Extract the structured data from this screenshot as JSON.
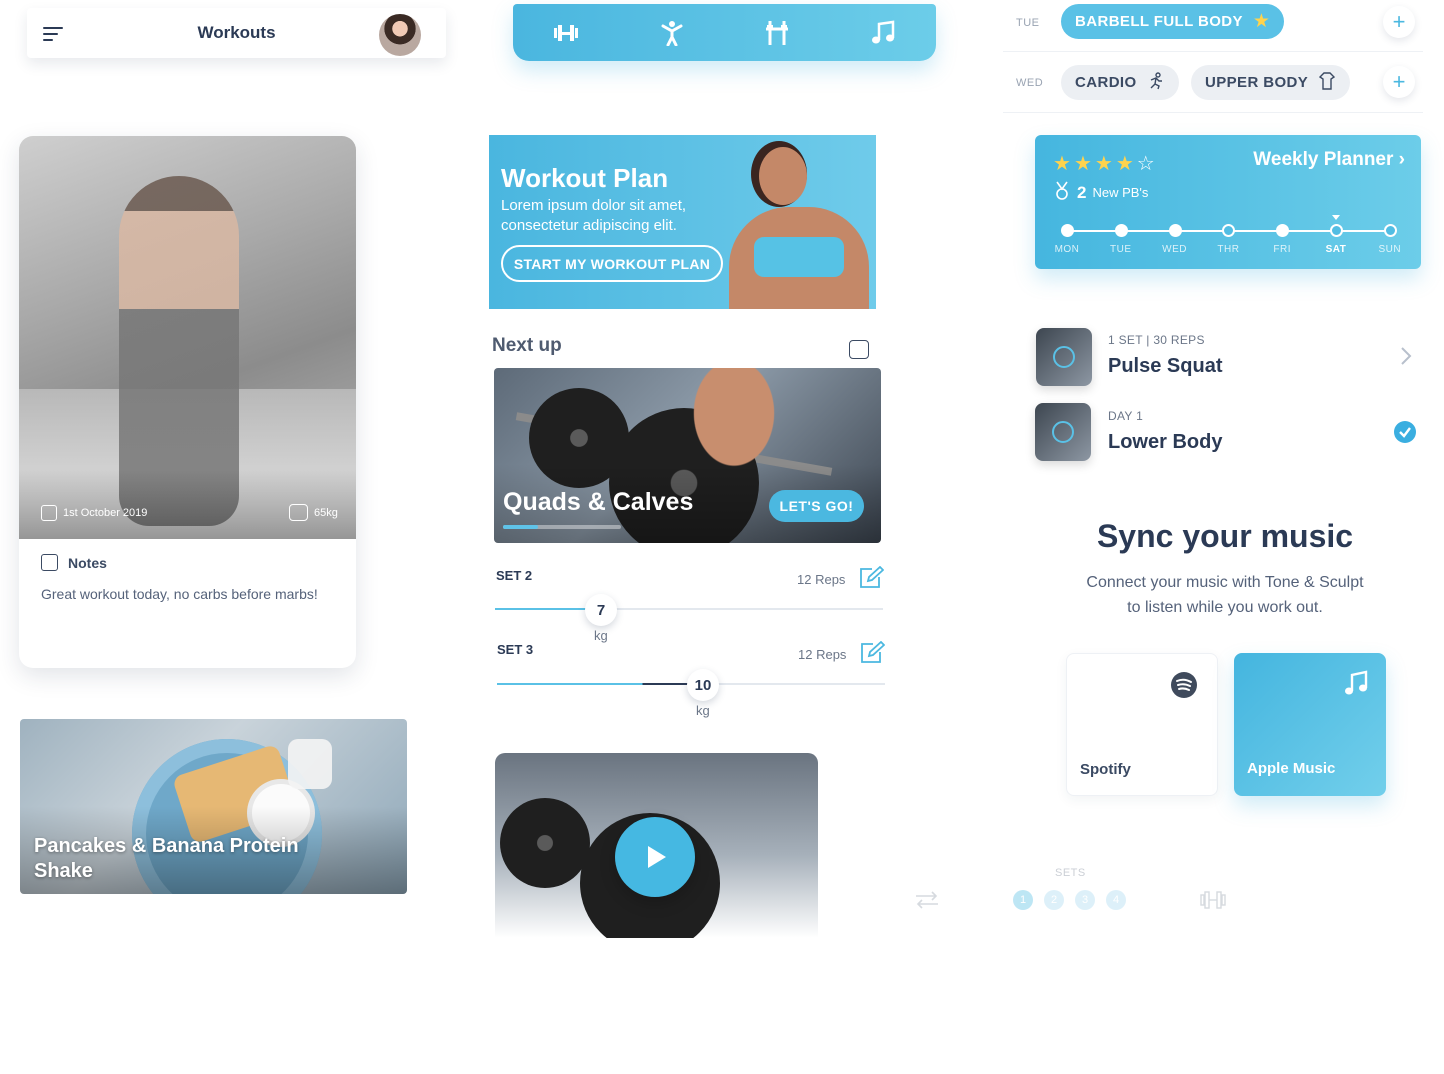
{
  "header": {
    "title": "Workouts"
  },
  "tabbar": {
    "icons": [
      "dumbbell-icon",
      "stretch-icon",
      "barbell-rack-icon",
      "music-icon"
    ]
  },
  "photo_card": {
    "date": "1st October 2019",
    "weight": "65kg",
    "notes_label": "Notes",
    "notes_text": "Great workout today, no carbs before marbs!"
  },
  "food_card": {
    "title": "Pancakes & Banana Protein Shake"
  },
  "plan": {
    "title": "Workout Plan",
    "text": "Lorem ipsum dolor sit amet, consectetur adipiscing elit.",
    "button": "START MY WORKOUT PLAN"
  },
  "next_up": {
    "label": "Next up",
    "workout_title": "Quads & Calves",
    "cta": "LET'S GO!",
    "progress": 0.3
  },
  "sets": [
    {
      "label": "SET 2",
      "reps": "12 Reps",
      "value": "7",
      "unit": "kg",
      "fill": 0.28
    },
    {
      "label": "SET 3",
      "reps": "12 Reps",
      "value": "10",
      "unit": "kg",
      "fill": 0.5
    }
  ],
  "schedule": {
    "rows": [
      {
        "day": "TUE",
        "pills": [
          {
            "label": "BARBELL FULL BODY",
            "style": "blue"
          }
        ]
      },
      {
        "day": "WED",
        "pills": [
          {
            "label": "CARDIO",
            "style": "grey"
          },
          {
            "label": "UPPER BODY",
            "style": "grey"
          }
        ]
      }
    ],
    "add_label": "+"
  },
  "planner": {
    "rating": 4,
    "link": "Weekly Planner",
    "pb_count": "2",
    "pb_label": "New PB's",
    "days": [
      "MON",
      "TUE",
      "WED",
      "THR",
      "FRI",
      "SAT",
      "SUN"
    ],
    "completed": [
      true,
      true,
      true,
      false,
      true,
      false,
      false
    ],
    "current_index": 5
  },
  "exercises": [
    {
      "subtitle": "1 SET | 30 REPS",
      "title": "Pulse Squat",
      "status": "next"
    },
    {
      "subtitle": "DAY 1",
      "title": "Lower Body",
      "status": "done"
    }
  ],
  "music": {
    "title": "Sync your music",
    "text_line1": "Connect your music with Tone & Sculpt",
    "text_line2": "to listen while you work out.",
    "spotify": "Spotify",
    "apple": "Apple Music"
  },
  "sets_footer": {
    "label": "SETS",
    "numbers": [
      "1",
      "2",
      "3",
      "4"
    ]
  },
  "colors": {
    "accent": "#4bb8e0",
    "accent_light": "#6ccde9",
    "text_dark": "#2b3a55",
    "pill_grey": "#eceff3"
  }
}
